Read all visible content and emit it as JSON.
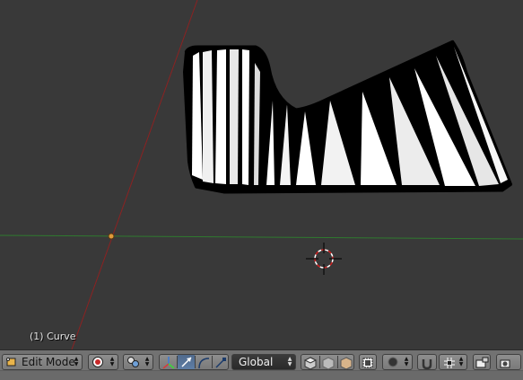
{
  "viewport": {
    "object_label": "(1) Curve"
  },
  "header": {
    "mode_label": "Edit Mode",
    "orientation_label": "Global"
  },
  "colors": {
    "viewport_bg": "#393939",
    "x_axis": "#8b2222",
    "y_axis": "#2f7a2f",
    "header_bg": "#727272",
    "manipulator_active": "#5f7ea6"
  },
  "icons": {
    "editor_type": "view3d-icon",
    "shading": "solid-shading-icon",
    "pivot": "pivot-point-icon",
    "manipulator": "manipulator-toggle-icon",
    "translate": "translate-arrow-icon",
    "rotate": "rotate-arc-icon",
    "scale": "scale-icon",
    "snap": "snap-magnet-icon",
    "render": "render-camera-icon"
  }
}
